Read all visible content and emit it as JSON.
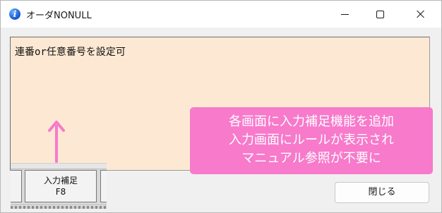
{
  "window": {
    "title": "オーダNONULL"
  },
  "textarea": {
    "value": "連番or任意番号を設定可"
  },
  "callout": {
    "lines": [
      "各画面に入力補足機能を追加",
      "入力画面にルールが表示され",
      "マニュアル参照が不要に"
    ],
    "color": "#f77acb"
  },
  "function_key": {
    "label": "入力補足",
    "key": "F8"
  },
  "buttons": {
    "close_label": "閉じる"
  },
  "colors": {
    "textarea_bg": "#fde9d3",
    "arrow": "#f77acb"
  },
  "icons": {
    "app": "info-icon",
    "minimize": "minimize-icon",
    "maximize": "maximize-icon",
    "close": "close-icon",
    "arrow": "arrow-up-icon"
  }
}
